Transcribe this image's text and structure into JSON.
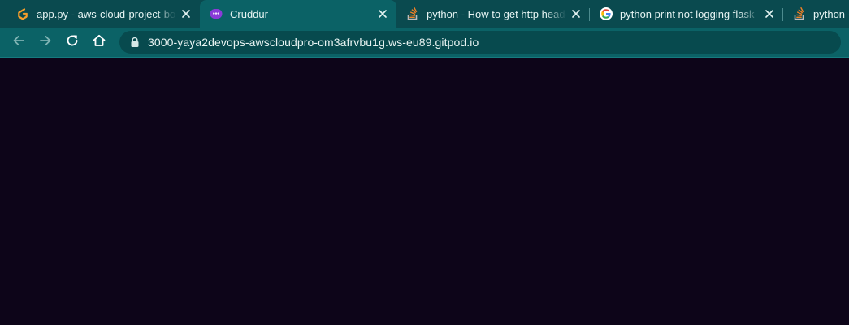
{
  "colors": {
    "tabstrip_bg": "#0a4a4f",
    "active_tab_bg": "#0b6266",
    "toolbar_bg": "#0b6266",
    "page_bg": "#0d0519"
  },
  "tabs": [
    {
      "title": "app.py - aws-cloud-project-bootcamp",
      "icon": "gitpod-icon",
      "active": false
    },
    {
      "title": "Cruddur",
      "icon": "cruddur-icon",
      "active": true
    },
    {
      "title": "python - How to get http headers in flask?",
      "icon": "stackoverflow-icon",
      "active": false
    },
    {
      "title": "python print not logging flask - Recherche Google",
      "icon": "google-icon",
      "active": false
    },
    {
      "title": "python - ",
      "icon": "stackoverflow-icon",
      "active": false
    }
  ],
  "toolbar": {
    "back": "back-arrow-icon",
    "forward": "forward-arrow-icon",
    "reload": "reload-icon",
    "home": "home-icon"
  },
  "address_bar": {
    "url": "3000-yaya2devops-awscloudpro-om3afrvbu1g.ws-eu89.gitpod.io",
    "security": "lock-icon"
  }
}
